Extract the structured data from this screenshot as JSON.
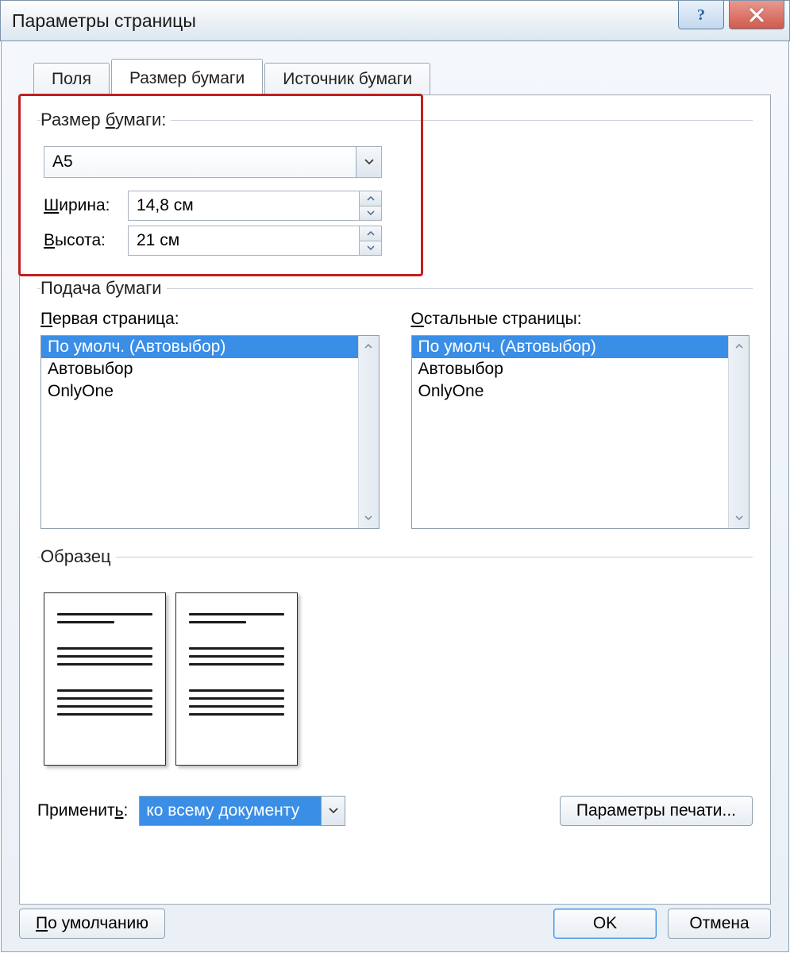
{
  "window": {
    "title": "Параметры страницы"
  },
  "tabs": {
    "fields": "Поля",
    "paper_size": "Размер бумаги",
    "paper_source": "Источник бумаги"
  },
  "paper_size": {
    "group_label": "Размер бумаги:",
    "selected": "A5",
    "width_label_pre": "Ш",
    "width_label_post": "ирина:",
    "height_label_pre": "В",
    "height_label_post": "ысота:",
    "width_value": "14,8 см",
    "height_value": "21 см"
  },
  "paper_feed": {
    "group_label": "Подача бумаги",
    "first_page_label_pre": "П",
    "first_page_label_post": "ервая страница:",
    "other_pages_label_pre": "О",
    "other_pages_label_post": "стальные страницы:",
    "items": [
      "По умолч. (Автовыбор)",
      "Автовыбор",
      "OnlyOne"
    ]
  },
  "preview": {
    "group_label": "Образец"
  },
  "apply": {
    "label_pre": "Применит",
    "label_post": ":",
    "label_ul": "ь",
    "value": "ко всему документу",
    "print_options": "Параметры печати..."
  },
  "buttons": {
    "default_pre": "П",
    "default_post": "о умолчанию",
    "ok": "OK",
    "cancel": "Отмена"
  }
}
